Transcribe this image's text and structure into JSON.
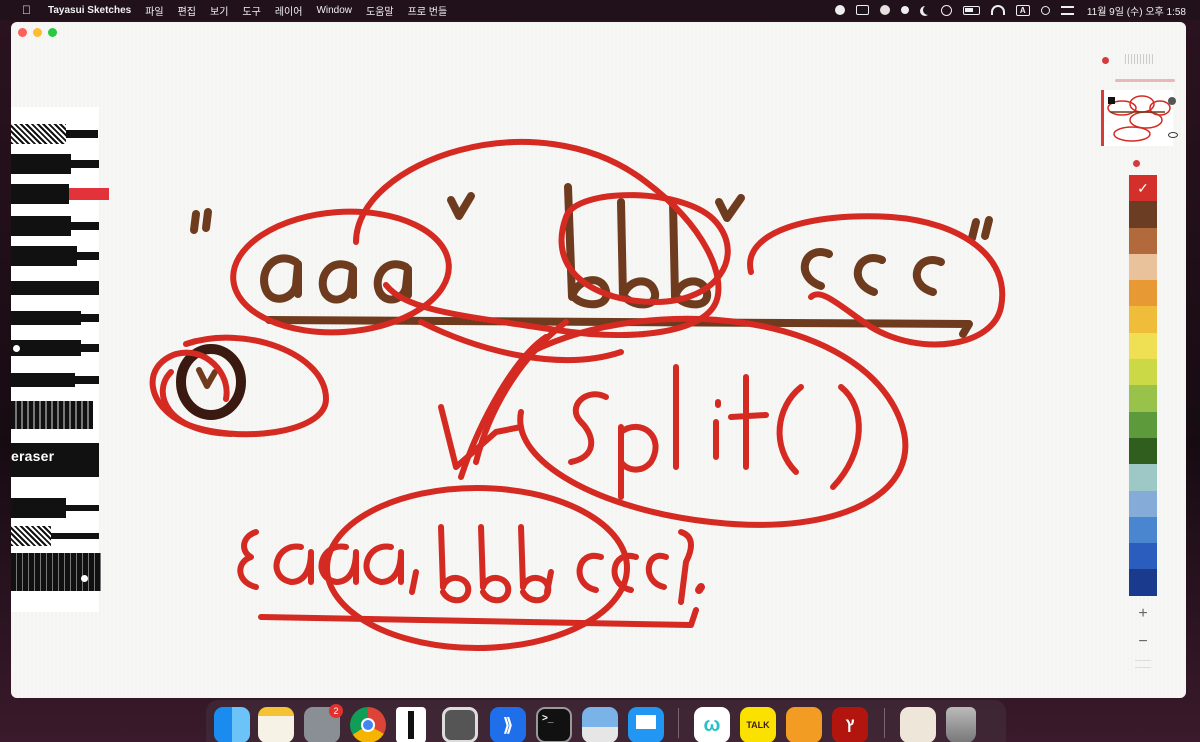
{
  "menubar": {
    "apple_icon": "apple-icon",
    "app_name": "Tayasui Sketches",
    "menus": [
      "파일",
      "편집",
      "보기",
      "도구",
      "레이어",
      "Window",
      "도움말",
      "프로 번들"
    ],
    "input_source": "A",
    "clock": "11월 9일 (수) 오후 1:58"
  },
  "tools": {
    "eraser_label": "eraser",
    "selected_tool": "marker",
    "selected_color": "#e2323a"
  },
  "drawing": {
    "text_aaa": "aaa",
    "text_bbb": "bbb",
    "text_ccc": "ccc",
    "text_split": "split()",
    "text_result": "{aaa, bbb, ccc}"
  },
  "palette": {
    "colors": [
      "#d4302b",
      "#6b3d22",
      "#b26a3c",
      "#e9c19b",
      "#e79a33",
      "#f0bd3b",
      "#efe053",
      "#cbd947",
      "#99c24a",
      "#5c9a3b",
      "#2f5e1e",
      "#9dc8c6",
      "#85acd8",
      "#4a86cf",
      "#2a5dbd",
      "#1a3a8e"
    ],
    "add_label": "+",
    "remove_label": "−"
  },
  "dock": {
    "apps": [
      "Finder",
      "Notes",
      "System Preferences",
      "Chrome",
      "Tayasui Sketches",
      "Calculator",
      "Visual Studio Code",
      "Terminal",
      "Preview",
      "Keynote",
      "Whale",
      "KakaoTalk",
      "Pages",
      "Acrobat",
      "Downloads",
      "Trash"
    ],
    "settings_badge": "2",
    "kakao_label": "TALK"
  },
  "colors": {
    "ink_red": "#d42a22",
    "ink_brown": "#6e3b1f",
    "ink_dark": "#3a1a10"
  }
}
